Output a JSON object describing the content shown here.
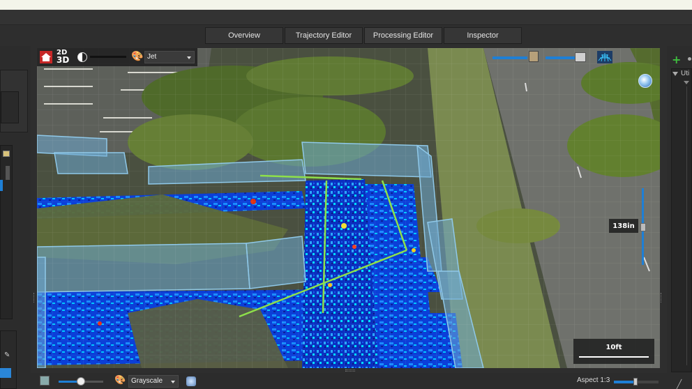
{
  "tabs": [
    {
      "label": "Overview"
    },
    {
      "label": "Trajectory Editor"
    },
    {
      "label": "Processing Editor"
    },
    {
      "label": "Inspector"
    }
  ],
  "viewport": {
    "toolbar": {
      "mode_label_top": "2D",
      "mode_label_bottom": "3D",
      "colormap": "Jet"
    },
    "zoom_label": "138in",
    "scale_label": "10ft",
    "icons": [
      "home-icon",
      "view-2d-3d-icon",
      "contrast-icon",
      "palette-icon",
      "building-icon",
      "trash-icon",
      "grid-icon",
      "globe-icon"
    ]
  },
  "bottom_toolbar": {
    "colormap": "Grayscale",
    "aspect_label": "Aspect 1:3",
    "aspect_level": 0.45,
    "opacity_level": 0.4
  },
  "right_panel": {
    "tree_label": "Uti"
  },
  "colors": {
    "accent": "#1e7fd6",
    "add": "#3fbf3f",
    "wall": "#7fb4d6",
    "path": "#8ee04a"
  }
}
